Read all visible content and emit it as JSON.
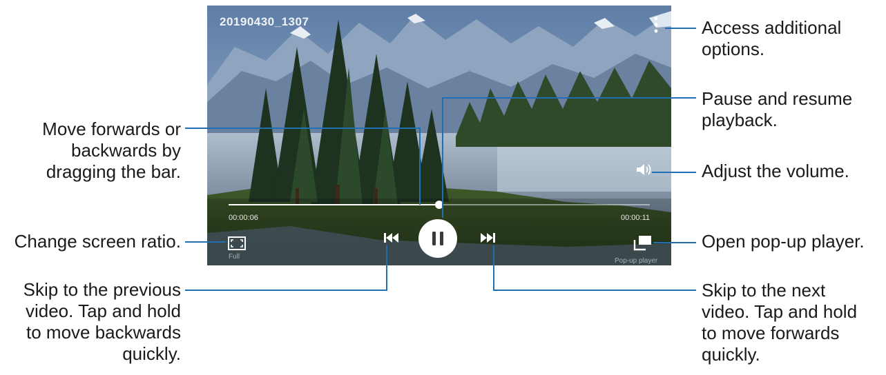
{
  "player": {
    "title": "20190430_1307",
    "elapsed": "00:00:06",
    "total": "00:00:11",
    "progress": 0.5,
    "ratio_label": "Full",
    "popup_label": "Pop-up player"
  },
  "callouts": {
    "options": [
      "Access additional",
      "options."
    ],
    "pause": [
      "Pause and resume",
      "playback."
    ],
    "volume": [
      "Adjust the volume."
    ],
    "popup": [
      "Open pop-up player."
    ],
    "next": [
      "Skip to the next",
      "video. Tap and hold",
      "to move forwards",
      "quickly."
    ],
    "seek": [
      "Move forwards or",
      "backwards by",
      "dragging the bar."
    ],
    "ratio": [
      "Change screen ratio."
    ],
    "prev": [
      "Skip to the previous",
      "video. Tap and hold",
      "to move backwards",
      "quickly."
    ]
  },
  "colors": {
    "leader": "#1f6fb2",
    "control": "#ffffff",
    "pause_icon": "#3a3a3a"
  },
  "icons": {
    "more": "more-options-icon",
    "pause": "pause-icon",
    "prev": "skip-previous-icon",
    "next": "skip-next-icon",
    "volume": "volume-icon",
    "ratio": "screen-ratio-icon",
    "popup": "popup-player-icon"
  }
}
